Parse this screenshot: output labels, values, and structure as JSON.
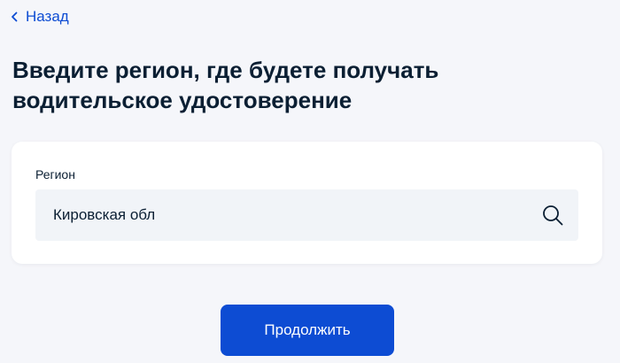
{
  "nav": {
    "back_label": "Назад"
  },
  "page": {
    "title": "Введите регион, где будете получать водительское удостоверение"
  },
  "form": {
    "region_label": "Регион",
    "region_value": "Кировская обл"
  },
  "actions": {
    "continue_label": "Продолжить"
  },
  "icons": {
    "back": "chevron-left-icon",
    "search": "search-icon"
  },
  "colors": {
    "accent": "#0d4cd3",
    "background": "#f5f6fa",
    "card": "#ffffff",
    "input_bg": "#f1f4f8",
    "text": "#0b1f33"
  }
}
